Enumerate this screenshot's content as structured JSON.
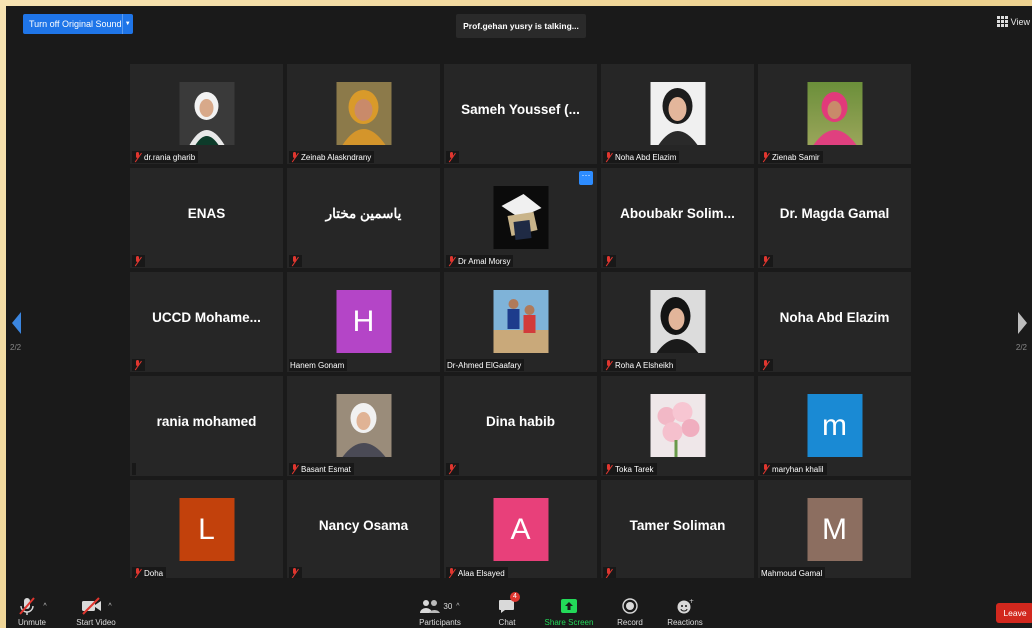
{
  "top": {
    "sound_button": "Turn off Original Sound",
    "talking": "Prof.gehan yusry is talking...",
    "view": "View"
  },
  "pager": {
    "left": "2/2",
    "right": "2/2"
  },
  "tiles": [
    {
      "name": "dr.rania gharib",
      "type": "photo",
      "muted": true
    },
    {
      "name": "Zeinab Alaskndrany",
      "type": "photo",
      "muted": true
    },
    {
      "name": "Sameh Youssef (...",
      "type": "text",
      "muted": true
    },
    {
      "name": "Noha Abd Elazim",
      "type": "photo",
      "muted": true
    },
    {
      "name": "Zienab Samir",
      "type": "photo",
      "muted": true
    },
    {
      "name": "ENAS",
      "type": "text",
      "muted": true
    },
    {
      "name": "ياسمين مختار",
      "type": "text",
      "muted": true
    },
    {
      "name": "Dr Amal Morsy",
      "type": "photo",
      "muted": true
    },
    {
      "name": "Aboubakr Solim...",
      "type": "text",
      "muted": true
    },
    {
      "name": "Dr. Magda Gamal",
      "type": "text",
      "muted": true
    },
    {
      "name": "UCCD Mohame...",
      "type": "text",
      "muted": true
    },
    {
      "name": "Hanem Gonam",
      "type": "letter",
      "letter": "H",
      "color": "#b445c7",
      "muted": false
    },
    {
      "name": "Dr-Ahmed ElGaafary",
      "type": "photo",
      "muted": false
    },
    {
      "name": "Roha A Elsheikh",
      "type": "photo",
      "muted": true
    },
    {
      "name": "Noha Abd Elazim",
      "type": "text",
      "muted": true
    },
    {
      "name": "rania mohamed",
      "type": "text",
      "muted": false
    },
    {
      "name": "Basant Esmat",
      "type": "photo",
      "muted": true
    },
    {
      "name": "Dina habib",
      "type": "text",
      "muted": true
    },
    {
      "name": "Toka Tarek",
      "type": "photo",
      "muted": true
    },
    {
      "name": "maryhan khalil",
      "type": "letter",
      "letter": "m",
      "color": "#1a8ad4",
      "muted": true
    },
    {
      "name": "Doha",
      "type": "letter",
      "letter": "L",
      "color": "#c2410c",
      "muted": true
    },
    {
      "name": "Nancy Osama",
      "type": "text",
      "muted": true
    },
    {
      "name": "Alaa Elsayed",
      "type": "letter",
      "letter": "A",
      "color": "#e8407a",
      "muted": true
    },
    {
      "name": "Tamer Soliman",
      "type": "text",
      "muted": true
    },
    {
      "name": "Mahmoud Gamal",
      "type": "letter",
      "letter": "M",
      "color": "#8c6e60",
      "muted": false
    }
  ],
  "toolbar": {
    "unmute": "Unmute",
    "start_video": "Start Video",
    "participants": "Participants",
    "participants_count": "30",
    "chat": "Chat",
    "chat_badge": "4",
    "share": "Share Screen",
    "record": "Record",
    "reactions": "Reactions",
    "leave": "Leave"
  },
  "colors": {
    "accent": "#2d8cff",
    "share": "#23d959",
    "leave": "#d2281e",
    "muted": "#e0362f"
  }
}
